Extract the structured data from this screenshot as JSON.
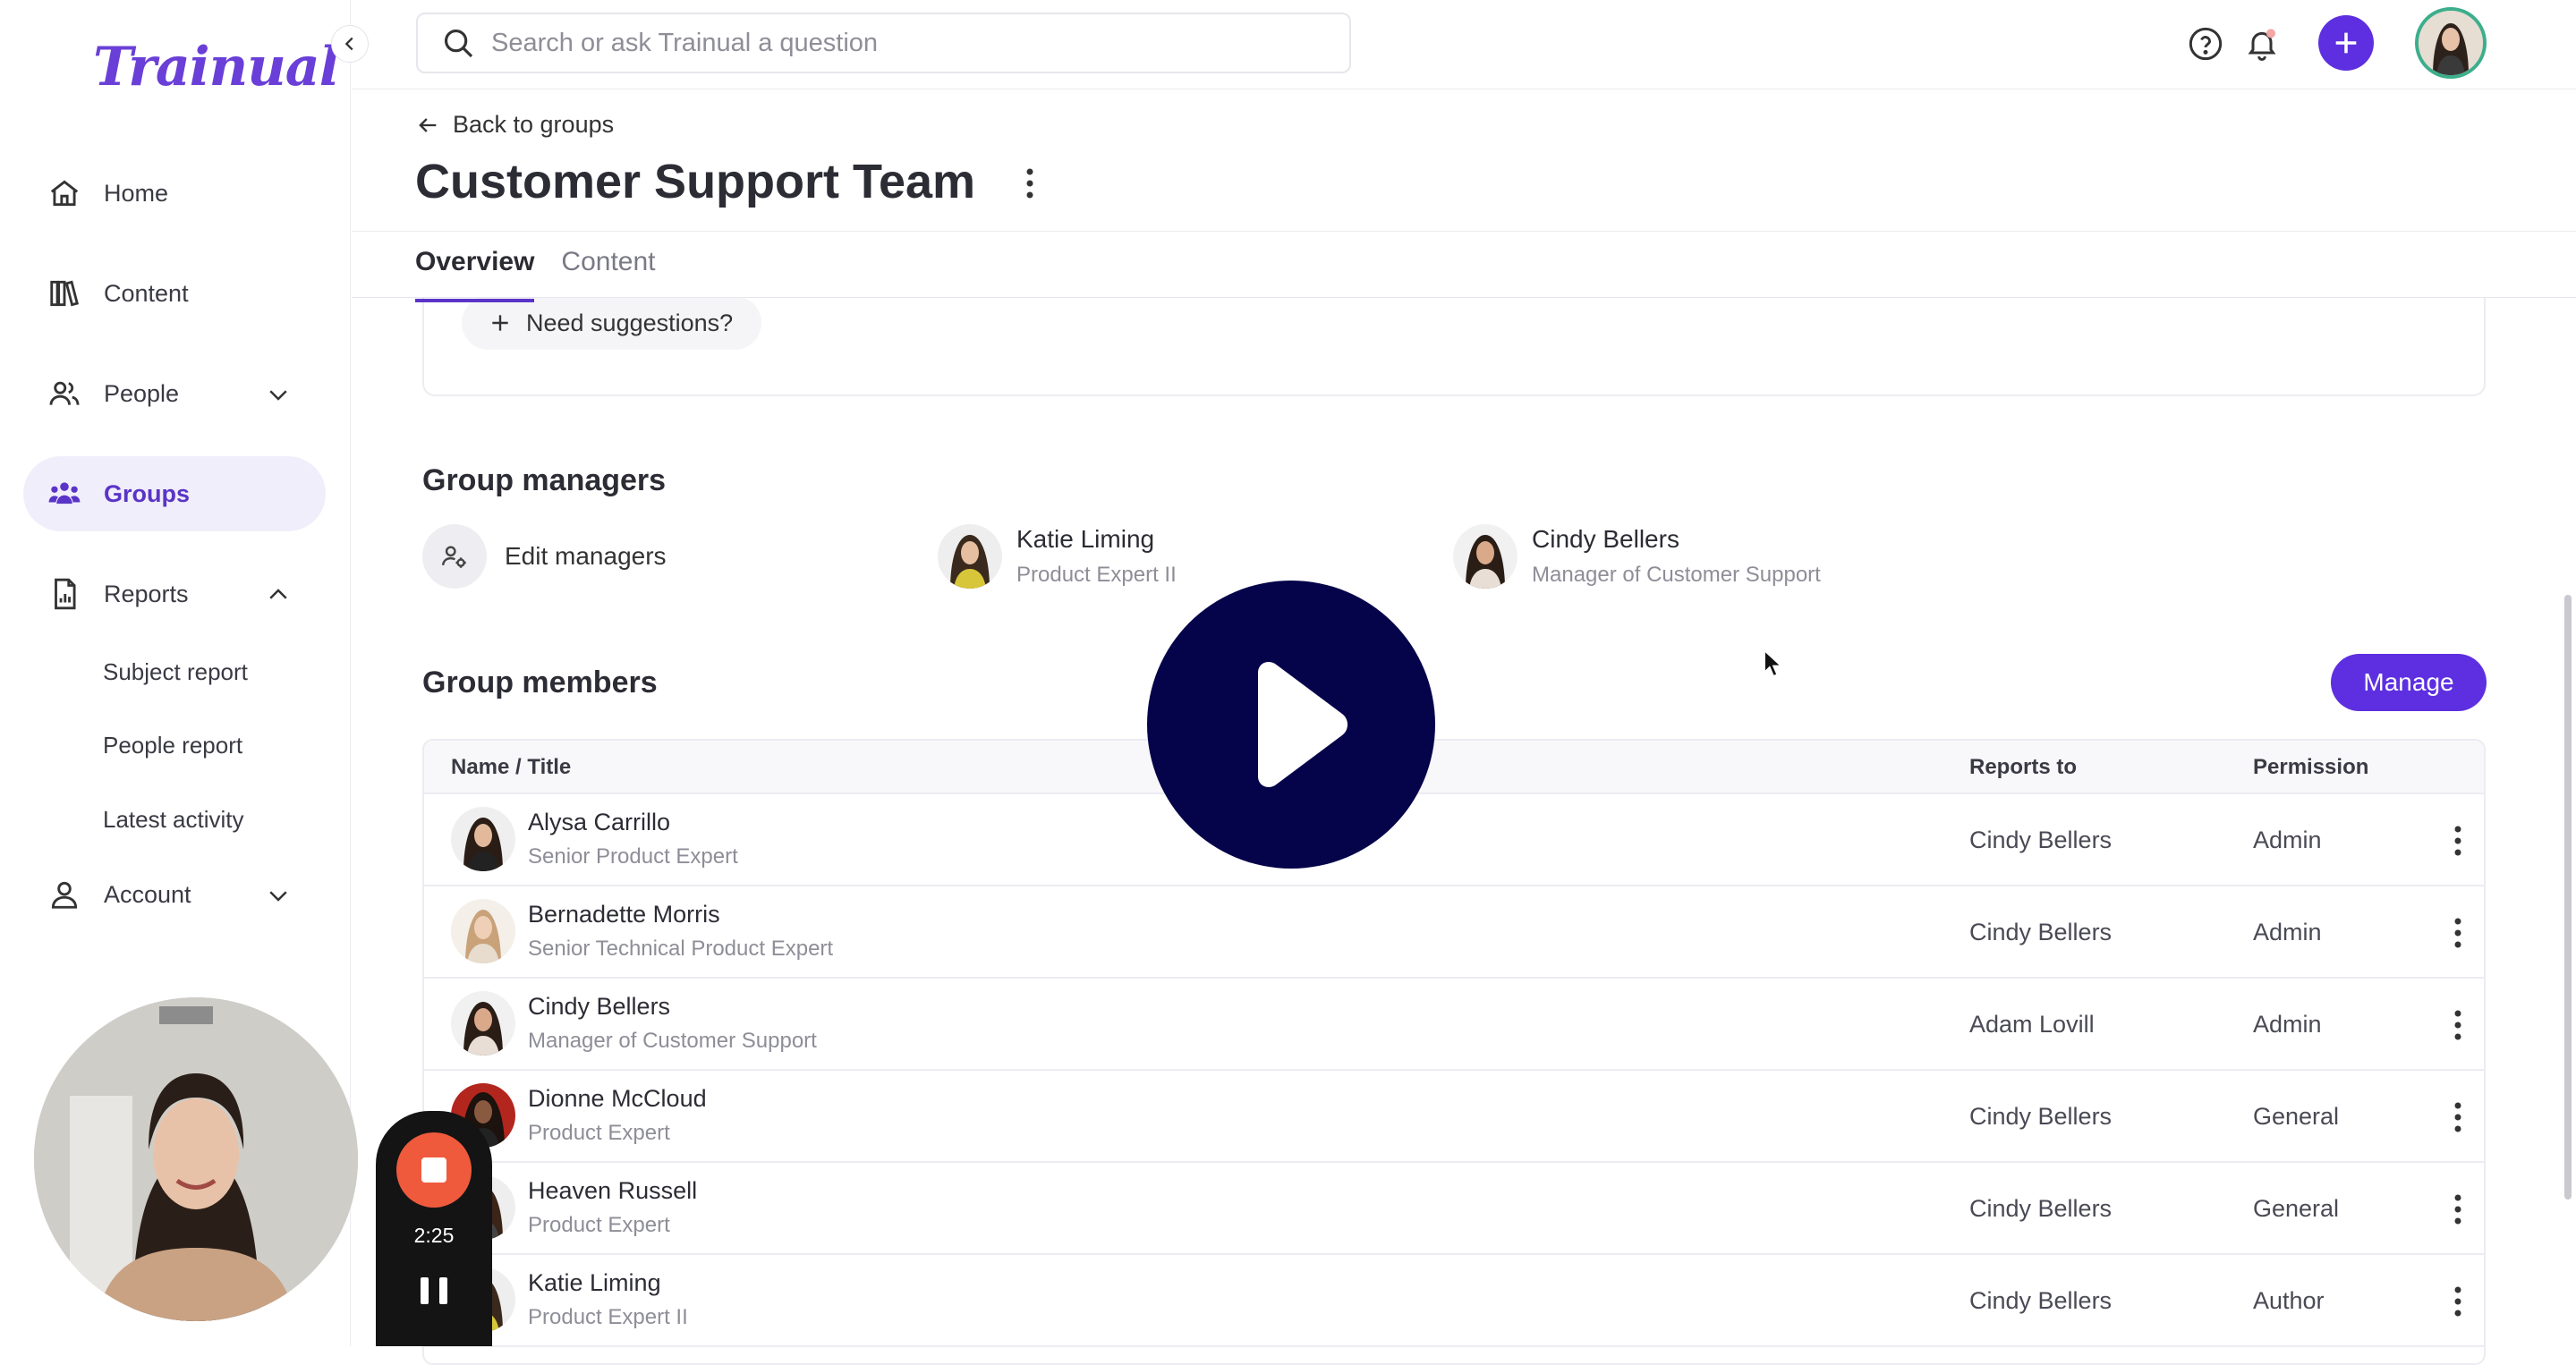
{
  "app": {
    "logo": "Trainual"
  },
  "search": {
    "placeholder": "Search or ask Trainual a question"
  },
  "sidebar": {
    "items": [
      {
        "label": "Home"
      },
      {
        "label": "Content"
      },
      {
        "label": "People"
      },
      {
        "label": "Groups"
      },
      {
        "label": "Reports"
      },
      {
        "label": "Account"
      }
    ],
    "reports_subitems": [
      "Subject report",
      "People report",
      "Latest activity"
    ]
  },
  "header": {
    "back_label": "Back to groups",
    "title": "Customer Support Team",
    "tabs": [
      "Overview",
      "Content"
    ],
    "active_tab": "Overview"
  },
  "suggestions": {
    "label": "Need suggestions?"
  },
  "managers": {
    "section_title": "Group managers",
    "edit_label": "Edit managers",
    "list": [
      {
        "name": "Katie Liming",
        "title": "Product Expert II"
      },
      {
        "name": "Cindy Bellers",
        "title": "Manager of Customer Support"
      }
    ]
  },
  "members": {
    "section_title": "Group members",
    "manage_label": "Manage",
    "columns": [
      "Name / Title",
      "Reports to",
      "Permission"
    ],
    "rows": [
      {
        "name": "Alysa Carrillo",
        "title": "Senior Product Expert",
        "reports_to": "Cindy Bellers",
        "permission": "Admin"
      },
      {
        "name": "Bernadette Morris",
        "title": "Senior Technical Product Expert",
        "reports_to": "Cindy Bellers",
        "permission": "Admin"
      },
      {
        "name": "Cindy Bellers",
        "title": "Manager of Customer Support",
        "reports_to": "Adam Lovill",
        "permission": "Admin"
      },
      {
        "name": "Dionne McCloud",
        "title": "Product Expert",
        "reports_to": "Cindy Bellers",
        "permission": "General"
      },
      {
        "name": "Heaven Russell",
        "title": "Product Expert",
        "reports_to": "Cindy Bellers",
        "permission": "General"
      },
      {
        "name": "Katie Liming",
        "title": "Product Expert II",
        "reports_to": "Cindy Bellers",
        "permission": "Author"
      }
    ]
  },
  "recorder": {
    "time": "2:25"
  },
  "colors": {
    "accent": "#5d2fe0",
    "active_nav_bg": "#f1eefb",
    "play_overlay": "#05044a",
    "record_button": "#ef5a3c"
  }
}
